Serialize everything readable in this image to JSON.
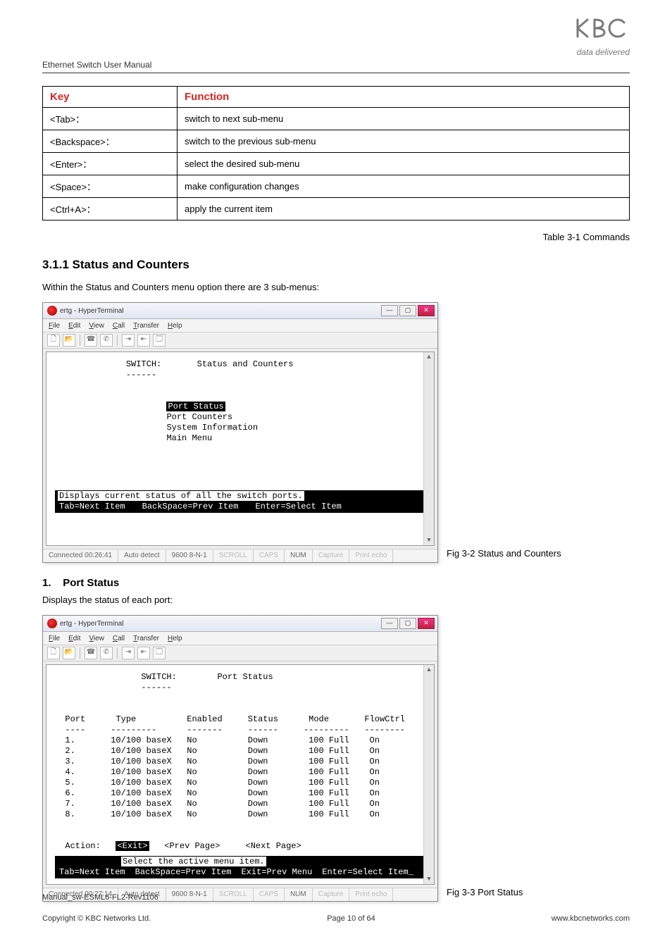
{
  "header": {
    "manual_title": "Ethernet Switch User Manual",
    "logo_sub": "data delivered"
  },
  "keytable": {
    "headers": {
      "key": "Key",
      "function": "Function"
    },
    "rows": [
      {
        "key": "<Tab>：",
        "function": "switch to next sub-menu"
      },
      {
        "key": "<Backspace>：",
        "function": "switch to the previous sub-menu"
      },
      {
        "key": "<Enter>：",
        "function": "select the desired sub-menu"
      },
      {
        "key": "<Space>：",
        "function": "make configuration changes"
      },
      {
        "key": "<Ctrl+A>：",
        "function": "apply the current item"
      }
    ],
    "caption": "Table 3-1 Commands"
  },
  "section_311": {
    "heading": "3.1.1 Status and Counters",
    "intro": "Within the Status and Counters menu option there are 3 sub-menus:"
  },
  "hyperterm": {
    "title": "ertg - HyperTerminal",
    "menubar": [
      "File",
      "Edit",
      "View",
      "Call",
      "Transfer",
      "Help"
    ],
    "winbtns": {
      "min": "—",
      "max": "▢",
      "close": "✕"
    },
    "status": {
      "connected1": "Connected 00:26:41",
      "connected2": "Connected 00:27:14",
      "autodetect": "Auto detect",
      "params": "9600 8-N-1",
      "scroll": "SCROLL",
      "caps": "CAPS",
      "num": "NUM",
      "capture": "Capture",
      "printecho": "Print echo"
    }
  },
  "term1": {
    "switch_label": "SWITCH:",
    "title": "Status and Counters",
    "menu": {
      "port_status": "Port Status",
      "port_counters": "Port Counters",
      "system_info": "System Information",
      "main_menu": "Main Menu"
    },
    "hint_line": "Displays current status of all the switch ports.",
    "nav": {
      "tab": "Tab=Next Item",
      "back": "BackSpace=Prev Item",
      "enter": "Enter=Select Item"
    },
    "figcaption": "Fig 3-2 Status and Counters"
  },
  "sub1": {
    "num": "1.",
    "title": "Port Status",
    "desc": "Displays the status of each port:"
  },
  "term2": {
    "switch_label": "SWITCH:",
    "title": "Port Status",
    "columns": {
      "port": "Port",
      "type": "Type",
      "enabled": "Enabled",
      "status": "Status",
      "mode": "Mode",
      "flowctrl": "FlowCtrl"
    },
    "rows": [
      {
        "port": "1.",
        "type": "10/100 baseX",
        "enabled": "No",
        "status": "Down",
        "mode": "100 Full",
        "flowctrl": "On"
      },
      {
        "port": "2.",
        "type": "10/100 baseX",
        "enabled": "No",
        "status": "Down",
        "mode": "100 Full",
        "flowctrl": "On"
      },
      {
        "port": "3.",
        "type": "10/100 baseX",
        "enabled": "No",
        "status": "Down",
        "mode": "100 Full",
        "flowctrl": "On"
      },
      {
        "port": "4.",
        "type": "10/100 baseX",
        "enabled": "No",
        "status": "Down",
        "mode": "100 Full",
        "flowctrl": "On"
      },
      {
        "port": "5.",
        "type": "10/100 baseX",
        "enabled": "No",
        "status": "Down",
        "mode": "100 Full",
        "flowctrl": "On"
      },
      {
        "port": "6.",
        "type": "10/100 baseX",
        "enabled": "No",
        "status": "Down",
        "mode": "100 Full",
        "flowctrl": "On"
      },
      {
        "port": "7.",
        "type": "10/100 baseX",
        "enabled": "No",
        "status": "Down",
        "mode": "100 Full",
        "flowctrl": "On"
      },
      {
        "port": "8.",
        "type": "10/100 baseX",
        "enabled": "No",
        "status": "Down",
        "mode": "100 Full",
        "flowctrl": "On"
      }
    ],
    "action_label": "Action:",
    "exit": "<Exit>",
    "prev": "<Prev Page>",
    "next": "<Next Page>",
    "hint_line": "Select the active menu item.",
    "nav": {
      "tab": "Tab=Next Item",
      "back": "BackSpace=Prev Item",
      "exitprev": "Exit=Prev Menu",
      "enter": "Enter=Select Item_"
    },
    "figcaption": "Fig 3-3 Port Status"
  },
  "footer": {
    "line1": "Manual_sw-ESML6-FL2-Rev1106",
    "left": "Copyright © KBC Networks Ltd.",
    "center": "Page 10 of 64",
    "right": "www.kbcnetworks.com"
  }
}
